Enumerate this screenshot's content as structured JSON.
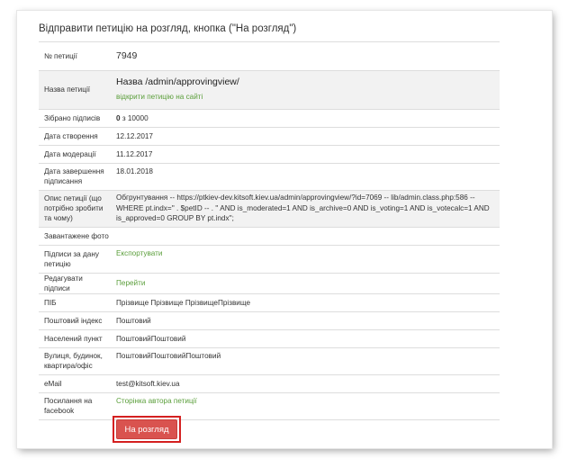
{
  "heading": "Відправити петицію на розгляд, кнопка (\"На розгляд\")",
  "rows": {
    "number": {
      "label": "№ петиції",
      "value": "7949"
    },
    "name": {
      "label": "Назва петиції",
      "value": "Назва /admin/approvingview/",
      "link": "відкрити петицію на сайті"
    },
    "signatures": {
      "label": "Зібрано підписів",
      "value_bold": "0",
      "value_rest": " з 10000"
    },
    "created": {
      "label": "Дата створення",
      "value": "12.12.2017"
    },
    "moderated": {
      "label": "Дата модерації",
      "value": "11.12.2017"
    },
    "signing_end": {
      "label": "Дата завершення підписання",
      "value": "18.01.2018"
    },
    "description": {
      "label": "Опис петиції (що потрібно зробити та чому)",
      "value": "Обгрунтування -- https://ptkiev-dev.kitsoft.kiev.ua/admin/approvingview/?id=7069 -- lib/admin.class.php:586 -- WHERE pt.indx='' . $petID -- . '' AND is_moderated=1 AND is_archive=0 AND is_voting=1 AND is_votecalc=1 AND is_approved=0 GROUP BY pt.indx'';"
    },
    "photo": {
      "label": "Завантажене фото",
      "value": ""
    },
    "petition_signatures": {
      "label": "Підписи за дану петицію",
      "link": "Експортувати"
    },
    "edit_signatures": {
      "label": "Редагувати підписи",
      "link": "Перейти"
    },
    "full_name": {
      "label": "ПІБ",
      "value": "Прізвище Прізвище ПрізвищеПрізвище"
    },
    "postal_code": {
      "label": "Поштовий індекс",
      "value": "Поштовий"
    },
    "locality": {
      "label": "Населений пункт",
      "value": "ПоштовийПоштовий"
    },
    "street": {
      "label": "Вулиця, будинок, квартира/офіс",
      "value": "ПоштовийПоштовийПоштовий"
    },
    "email": {
      "label": "eMail",
      "value": "test@kitsoft.kiev.ua"
    },
    "facebook": {
      "label": "Посилання на facebook",
      "link": "Сторінка автора петиції"
    }
  },
  "submit_button": "На розгляд",
  "colors": {
    "link": "#5a9e3a",
    "button": "#d9534f",
    "highlight": "#d42020",
    "shade": "#f2f2f2"
  }
}
